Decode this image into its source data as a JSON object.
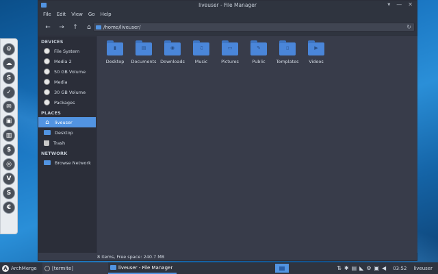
{
  "window": {
    "title": "liveuser - File Manager",
    "controls": [
      "▾",
      "—",
      "✕"
    ]
  },
  "menu": [
    "File",
    "Edit",
    "View",
    "Go",
    "Help"
  ],
  "location": {
    "path": "/home/liveuser/"
  },
  "sidebar": {
    "devices_header": "DEVICES",
    "devices": [
      "File System",
      "Media 2",
      "50 GB Volume",
      "Media",
      "30 GB Volume",
      "Packages"
    ],
    "places_header": "PLACES",
    "places": [
      "liveuser",
      "Desktop",
      "Trash"
    ],
    "network_header": "NETWORK",
    "network": [
      "Browse Network"
    ]
  },
  "files": [
    {
      "name": "Desktop",
      "glyph": "▮"
    },
    {
      "name": "Documents",
      "glyph": "▤"
    },
    {
      "name": "Downloads",
      "glyph": "◉"
    },
    {
      "name": "Music",
      "glyph": "♫"
    },
    {
      "name": "Pictures",
      "glyph": "▭"
    },
    {
      "name": "Public",
      "glyph": "✎"
    },
    {
      "name": "Templates",
      "glyph": "▯"
    },
    {
      "name": "Videos",
      "glyph": "▶"
    }
  ],
  "status": "8 items, Free space: 240.7 MB",
  "taskbar": {
    "start_label": "ArchMerge",
    "task1": "[termite]",
    "task2": "liveuser - File Manager",
    "clock": "03:52",
    "user": "liveuser"
  },
  "dock_glyphs": [
    "⚙",
    "☁",
    "S",
    "✓",
    "✉",
    "▣",
    "▥",
    "$",
    "◎",
    "V",
    "S",
    "€"
  ]
}
